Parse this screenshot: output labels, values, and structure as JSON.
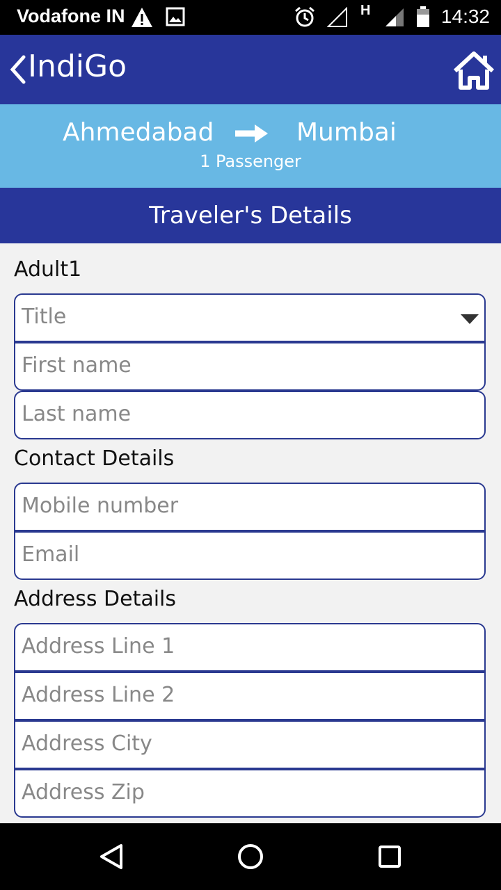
{
  "status_bar": {
    "carrier": "Vodafone IN",
    "network_label": "H",
    "time": "14:32",
    "icons": [
      "warning-icon",
      "image-icon",
      "alarm-icon",
      "signal-empty-icon",
      "signal-icon",
      "battery-icon"
    ]
  },
  "app_bar": {
    "title": "IndiGo",
    "back_icon": "chevron-left-icon",
    "home_icon": "home-icon"
  },
  "route": {
    "from": "Ahmedabad",
    "to": "Mumbai",
    "passengers": "1 Passenger"
  },
  "section_title": "Traveler's Details",
  "form": {
    "adult_label": "Adult1",
    "title_placeholder": "Title",
    "first_name_placeholder": "First name",
    "last_name_placeholder": "Last name",
    "contact_label": "Contact Details",
    "mobile_placeholder": "Mobile number",
    "email_placeholder": "Email",
    "address_label": "Address Details",
    "address1_placeholder": "Address Line 1",
    "address2_placeholder": "Address Line 2",
    "city_placeholder": "Address City",
    "zip_placeholder": "Address Zip"
  },
  "nav_bar": {
    "icons": [
      "back-triangle-icon",
      "home-circle-icon",
      "recents-square-icon"
    ]
  },
  "colors": {
    "primary": "#28369a",
    "route_bg": "#68b8e4",
    "background": "#f2f2f2",
    "field_border": "#2a3990"
  }
}
